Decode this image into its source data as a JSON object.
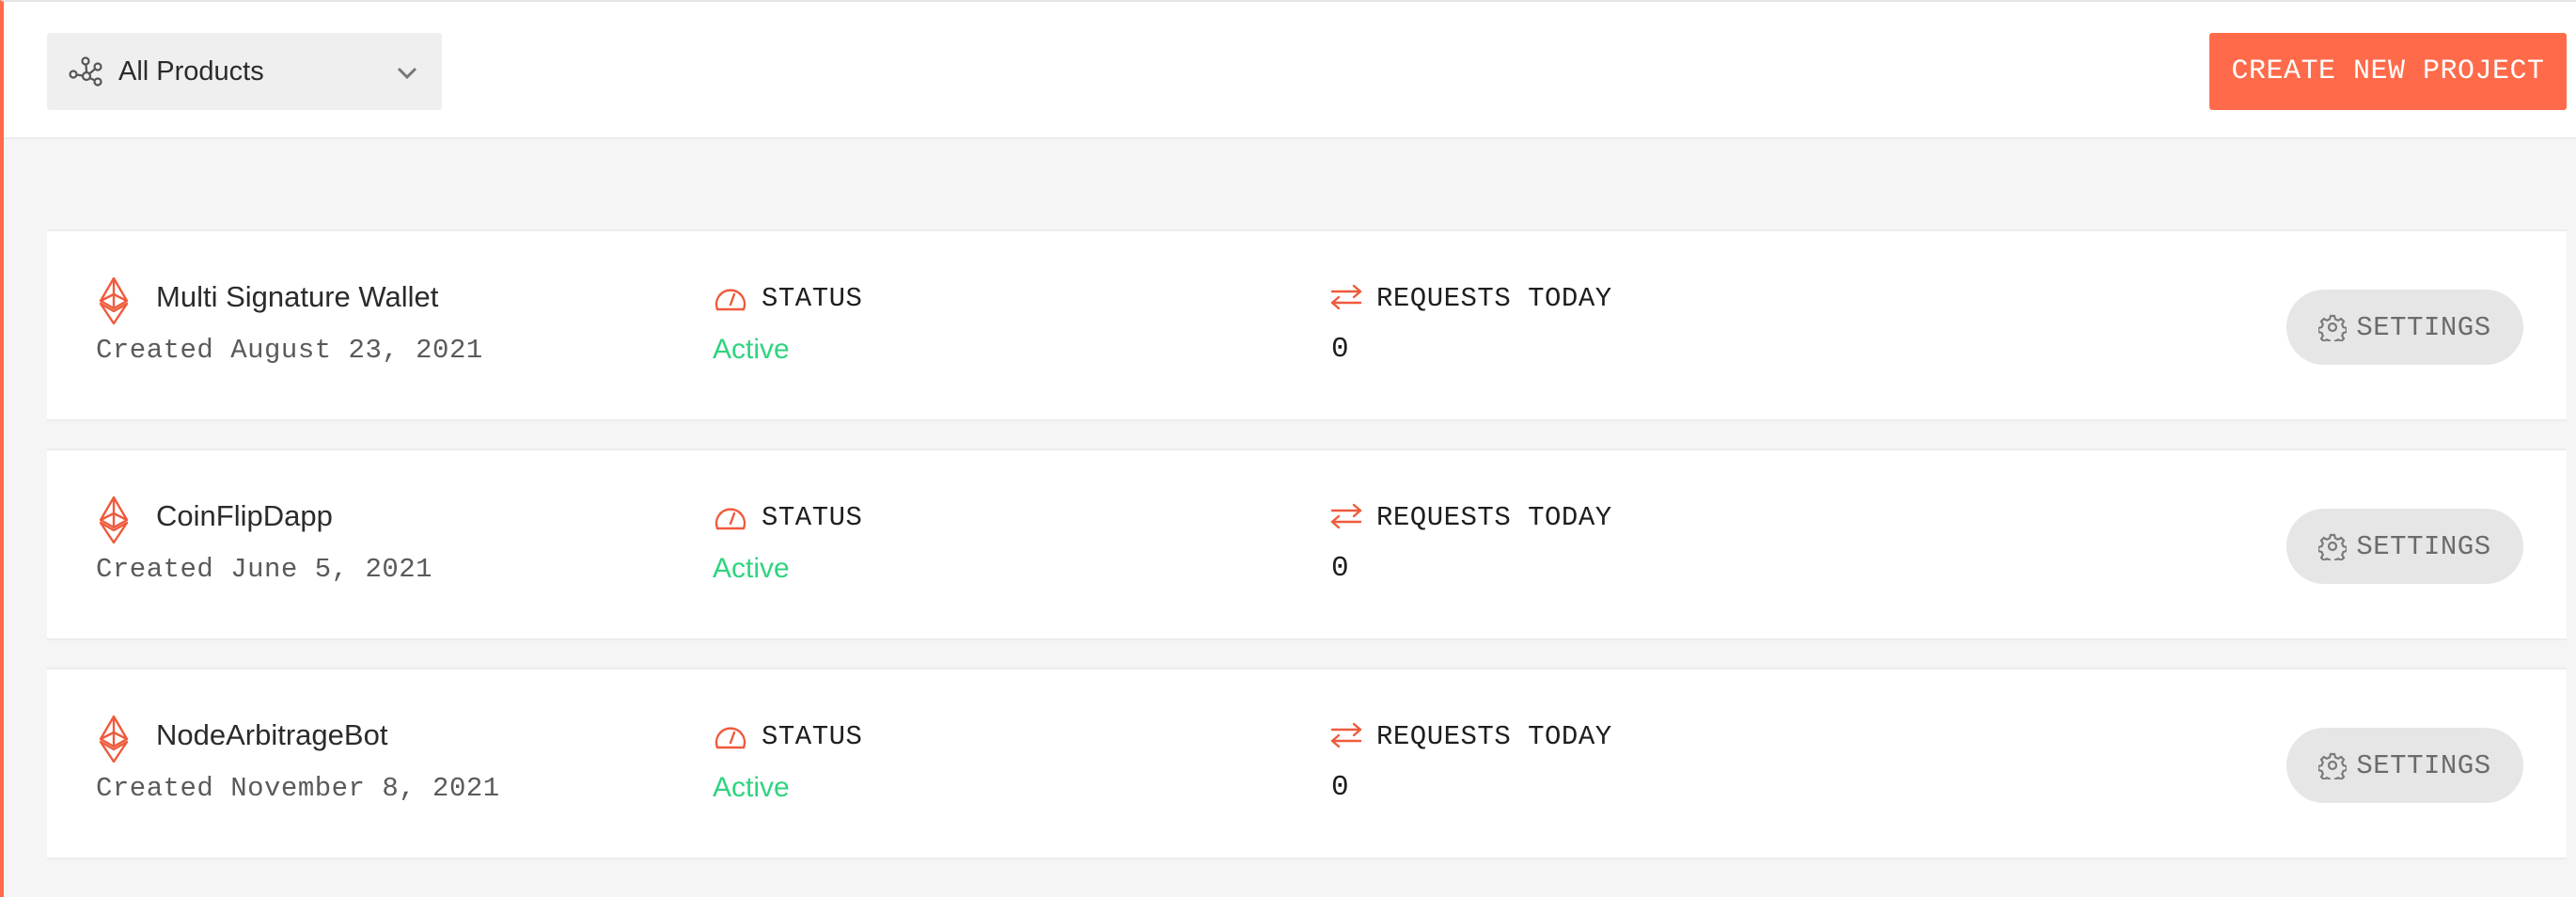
{
  "header": {
    "product_filter": {
      "selected": "All Products",
      "icon": "nodes-icon"
    },
    "create_button_label": "CREATE NEW PROJECT"
  },
  "columns": {
    "status_label": "STATUS",
    "requests_label": "REQUESTS TODAY"
  },
  "projects": [
    {
      "name": "Multi Signature Wallet",
      "created": "Created August 23, 2021",
      "status": "Active",
      "requests_today": "0",
      "settings_label": "SETTINGS"
    },
    {
      "name": "CoinFlipDapp",
      "created": "Created June 5, 2021",
      "status": "Active",
      "requests_today": "0",
      "settings_label": "SETTINGS"
    },
    {
      "name": "NodeArbitrageBot",
      "created": "Created November 8, 2021",
      "status": "Active",
      "requests_today": "0",
      "settings_label": "SETTINGS"
    }
  ],
  "colors": {
    "accent": "#ff6b4a",
    "status_active": "#2ed47f",
    "settings_bg": "#e6e6e6"
  }
}
